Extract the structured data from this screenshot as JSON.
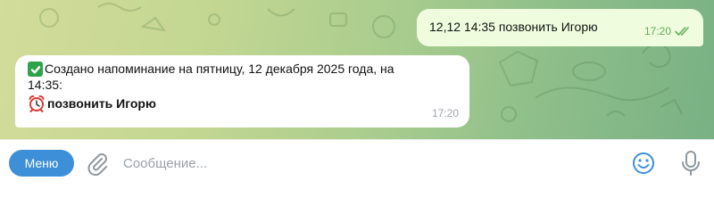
{
  "chat": {
    "outgoing": {
      "text": "12,12 14:35 позвонить Игорю",
      "time": "17:20",
      "status_icon": "double-check-icon"
    },
    "incoming": {
      "line1": "Создано напоминание на пятницу, 12 декабря 2025 года, на",
      "line2": "14:35:",
      "line3": "позвонить Игорю",
      "time": "17:20",
      "icons": [
        "check-mark-icon",
        "alarm-clock-icon"
      ]
    }
  },
  "composer": {
    "menu_label": "Меню",
    "placeholder": "Сообщение...",
    "icons": [
      "paperclip-icon",
      "emoji-icon",
      "microphone-icon"
    ]
  },
  "colors": {
    "outgoing_bubble": "#effdde",
    "incoming_bubble": "#ffffff",
    "accent": "#3d8fd8",
    "read_checks": "#5fb556"
  }
}
